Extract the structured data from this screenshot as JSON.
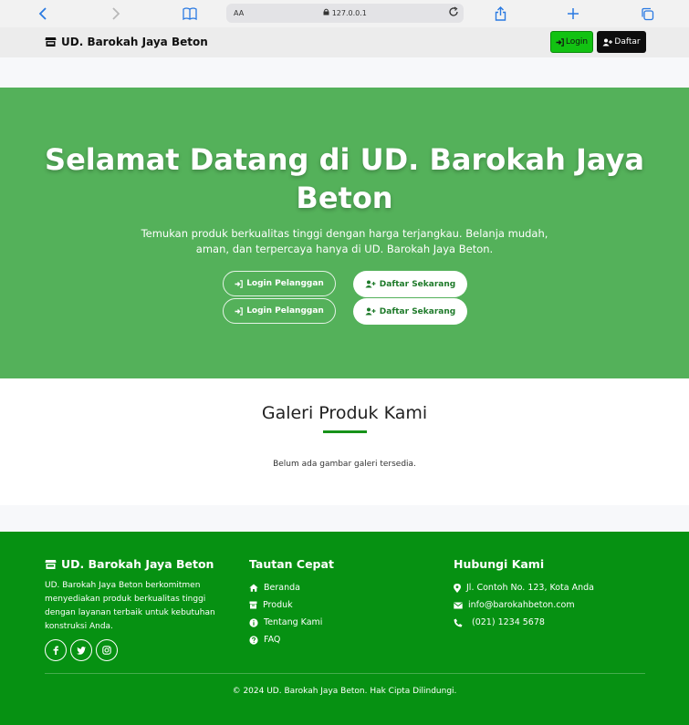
{
  "browser": {
    "text_size_label": "AA",
    "url": "127.0.0.1"
  },
  "navbar": {
    "brand": "UD. Barokah Jaya Beton",
    "login_label": "Login",
    "register_label": "Daftar"
  },
  "hero": {
    "title": "Selamat Datang di UD. Barokah Jaya Beton",
    "subtitle": "Temukan produk berkualitas tinggi dengan harga terjangkau. Belanja mudah, aman, dan terpercaya hanya di UD. Barokah Jaya Beton.",
    "buttons": [
      {
        "login_label": "Login Pelanggan",
        "register_label": "Daftar Sekarang"
      },
      {
        "login_label": "Login Pelanggan",
        "register_label": "Daftar Sekarang"
      }
    ]
  },
  "gallery": {
    "title": "Galeri Produk Kami",
    "empty_text": "Belum ada gambar galeri tersedia."
  },
  "footer": {
    "about": {
      "title": "UD. Barokah Jaya Beton",
      "text": "UD. Barokah Jaya Beton berkomitmen menyediakan produk berkualitas tinggi dengan layanan terbaik untuk kebutuhan konstruksi Anda.",
      "socials": [
        "f",
        "t",
        "ig"
      ]
    },
    "links": {
      "title": "Tautan Cepat",
      "items": [
        "Beranda",
        "Produk",
        "Tentang Kami",
        "FAQ"
      ]
    },
    "contact": {
      "title": "Hubungi Kami",
      "address": "Jl. Contoh No. 123, Kota Anda",
      "email": "info@barokahbeton.com",
      "phone": "(021) 1234 5678"
    },
    "copyright": "© 2024 UD. Barokah Jaya Beton. Hak Cipta Dilindungi."
  },
  "colors": {
    "hero_bg": "#54b15a",
    "footer_bg": "#069112",
    "login_btn": "#12c212",
    "register_btn": "#0d0d0d",
    "accent_line": "#179219"
  }
}
